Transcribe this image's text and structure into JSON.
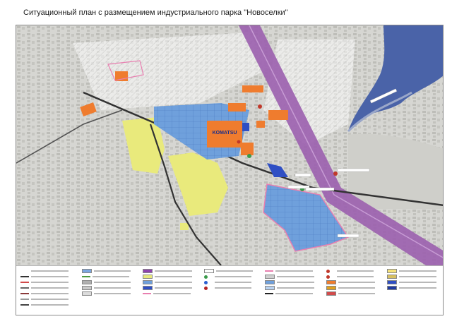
{
  "title": "Ситуационный план с размещением индустриального парка \"Новоселки\"",
  "labels": {
    "komatsu": "KOMATSU"
  },
  "colors": {
    "map_bg": "#d8d8d5",
    "river": "#4a63a8",
    "park": "#6fa0dc",
    "industrial": "#ef7c2e",
    "yellow_zone": "#e9ea7c",
    "railway": "#333333",
    "highway": "#9b5fae",
    "boundary": "#e87fb0",
    "blue_dark": "#2f4fc4"
  },
  "legend": {
    "columns": [
      {
        "items": [
          {
            "color": "#ffffff",
            "kind": "line"
          },
          {
            "color": "#333333",
            "kind": "line"
          },
          {
            "color": "#d24b4b",
            "kind": "line"
          },
          {
            "color": "#666666",
            "kind": "line"
          },
          {
            "color": "#8b3a3a",
            "kind": "line"
          },
          {
            "color": "#999999",
            "kind": "line"
          },
          {
            "color": "#444444",
            "kind": "line"
          }
        ]
      },
      {
        "items": [
          {
            "color": "#7ba7e0",
            "kind": "fill"
          },
          {
            "color": "#4c9a3e",
            "kind": "line"
          },
          {
            "color": "#b0b0b0",
            "kind": "fill"
          },
          {
            "color": "#c9c9c9",
            "kind": "fill"
          },
          {
            "color": "#dcdcdc",
            "kind": "fill"
          }
        ]
      },
      {
        "items": [
          {
            "color": "#8e44ad",
            "kind": "fill"
          },
          {
            "color": "#e9ea7c",
            "kind": "fill"
          },
          {
            "color": "#6fa0dc",
            "kind": "fill"
          },
          {
            "color": "#2f4fc4",
            "kind": "fill"
          },
          {
            "color": "#e87fb0",
            "kind": "line"
          }
        ]
      },
      {
        "items": [
          {
            "color": "#ffffff",
            "kind": "fill"
          },
          {
            "color": "#3a9a4a",
            "kind": "dot"
          },
          {
            "color": "#2a5fd0",
            "kind": "dot"
          },
          {
            "color": "#b22222",
            "kind": "dot"
          }
        ]
      },
      {
        "items": [
          {
            "color": "#e87fb0",
            "kind": "line"
          },
          {
            "color": "#cfcfcf",
            "kind": "fill"
          },
          {
            "color": "#6fa0dc",
            "kind": "fill"
          },
          {
            "color": "#b9d2f0",
            "kind": "fill"
          },
          {
            "color": "#222222",
            "kind": "line"
          }
        ]
      },
      {
        "items": [
          {
            "color": "#c0392b",
            "kind": "dot"
          },
          {
            "color": "#c0392b",
            "kind": "dot"
          },
          {
            "color": "#ef7c2e",
            "kind": "fill"
          },
          {
            "color": "#e0a020",
            "kind": "fill"
          },
          {
            "color": "#d24b4b",
            "kind": "fill"
          }
        ]
      },
      {
        "items": [
          {
            "color": "#f5e27a",
            "kind": "fill"
          },
          {
            "color": "#d8c060",
            "kind": "fill"
          },
          {
            "color": "#2f4fc4",
            "kind": "fill"
          },
          {
            "color": "#1f3aa0",
            "kind": "fill"
          }
        ]
      }
    ]
  }
}
